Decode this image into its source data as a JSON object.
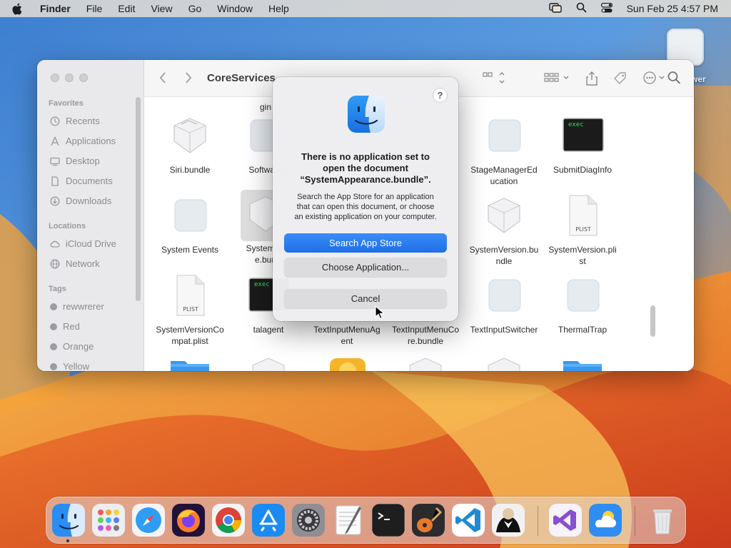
{
  "menubar": {
    "app_name": "Finder",
    "menus": [
      "File",
      "Edit",
      "View",
      "Go",
      "Window",
      "Help"
    ],
    "clock": "Sun Feb 25  4:57 PM"
  },
  "desktop": {
    "icon_label": "wer"
  },
  "finder": {
    "folder_title": "CoreServices",
    "sidebar": {
      "favorites_header": "Favorites",
      "favorites": [
        "Recents",
        "Applications",
        "Desktop",
        "Documents",
        "Downloads"
      ],
      "locations_header": "Locations",
      "locations": [
        "iCloud Drive",
        "Network"
      ],
      "tags_header": "Tags",
      "tags": [
        "rewwrerer",
        "Red",
        "Orange",
        "Yellow"
      ]
    },
    "files": [
      {
        "label": "gin",
        "kind": "partial"
      },
      {
        "label": "Siri.bundle",
        "kind": "bundle"
      },
      {
        "label": "Software",
        "kind": "app"
      },
      {
        "label": "StageManagerEducation",
        "kind": "app"
      },
      {
        "label": "SubmitDiagInfo",
        "kind": "exec"
      },
      {
        "label": "System Events",
        "kind": "app"
      },
      {
        "label": "SystemAppearance.bundle",
        "kind": "bundle",
        "selected": true
      },
      {
        "label": "SystemVersion.bundle",
        "kind": "bundle"
      },
      {
        "label": "SystemVersion.plist",
        "kind": "plist"
      },
      {
        "label": "SystemVersionCompat.plist",
        "kind": "plist"
      },
      {
        "label": "talagent",
        "kind": "exec"
      },
      {
        "label": "TextInputMenuAgent",
        "kind": "app"
      },
      {
        "label": "TextInputMenuCore.bundle",
        "kind": "bundle"
      },
      {
        "label": "TextInputSwitcher",
        "kind": "app"
      },
      {
        "label": "ThermalTrap",
        "kind": "app"
      }
    ],
    "file_labels_display": {
      "gin": "gin",
      "siri": "Siri.bundle",
      "software": "Software",
      "stage_1": "StageManagerEd",
      "stage_2": "ucation",
      "submit": "SubmitDiagInfo",
      "events": "System Events",
      "appearance_1": "SystemAp",
      "appearance_2": "e.bun",
      "sysver_b1": "SystemVersion.bu",
      "sysver_b2": "ndle",
      "sysver_p1": "SystemVersion.pli",
      "sysver_p2": "st",
      "compat_1": "SystemVersionCo",
      "compat_2": "mpat.plist",
      "talagent": "talagent",
      "tima_1": "TextInputMenuAg",
      "tima_2": "ent",
      "timc_1": "TextInputMenuCo",
      "timc_2": "re.bundle",
      "tis": "TextInputSwitcher",
      "thermal": "ThermalTrap"
    },
    "exec_text": "exec",
    "plist_text": "PLIST"
  },
  "dialog": {
    "help": "?",
    "title_lines": [
      "There is no application set to",
      "open the document",
      "“SystemAppearance.bundle”."
    ],
    "message_lines": [
      "Search the App Store for an application",
      "that can open this document, or choose",
      "an existing application on your computer."
    ],
    "primary_button": "Search App Store",
    "secondary_button": "Choose Application...",
    "cancel_button": "Cancel"
  },
  "dock": {
    "apps": [
      "Finder",
      "Launchpad",
      "Safari",
      "Firefox",
      "Chrome",
      "App Store",
      "System Settings",
      "TextEdit",
      "Terminal",
      "GarageBand",
      "Visual Studio Code",
      "Bartender",
      "Visual Studio",
      "Weather",
      "Trash"
    ]
  },
  "colors": {
    "accent": "#1f6fe8",
    "selection": "#2b63d9"
  }
}
